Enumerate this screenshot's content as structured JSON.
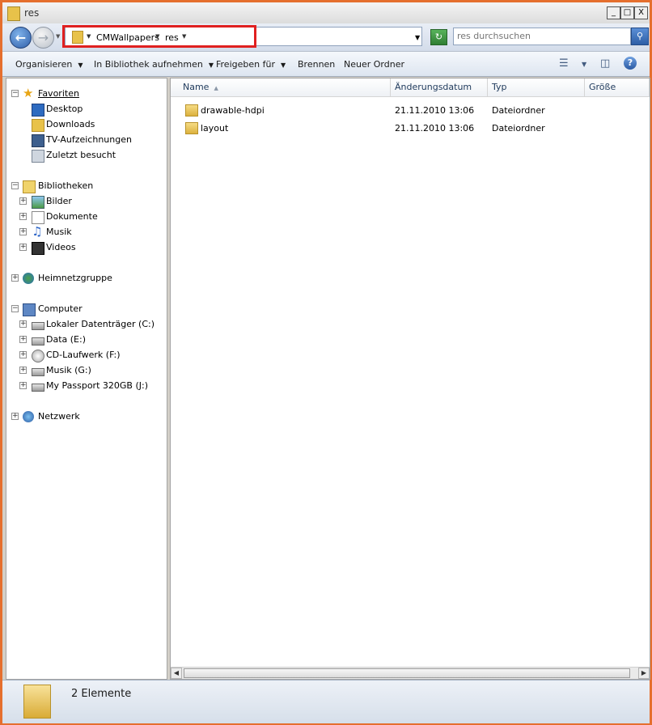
{
  "window": {
    "title": "res"
  },
  "titlebar_buttons": {
    "minimize": "_",
    "maximize": "□",
    "close": "X"
  },
  "address": {
    "crumbs": [
      "CMWallpapers",
      "res"
    ],
    "search_placeholder": "res durchsuchen",
    "search_value": ""
  },
  "toolbar": {
    "organize": "Organisieren",
    "include_library": "In Bibliothek aufnehmen",
    "share_with": "Freigeben für",
    "burn": "Brennen",
    "new_folder": "Neuer Ordner",
    "help": "?"
  },
  "nav": {
    "favorites": {
      "label": "Favoriten",
      "items": [
        "Desktop",
        "Downloads",
        "TV-Aufzeichnungen",
        "Zuletzt besucht"
      ]
    },
    "libraries": {
      "label": "Bibliotheken",
      "items": [
        "Bilder",
        "Dokumente",
        "Musik",
        "Videos"
      ]
    },
    "homegroup": "Heimnetzgruppe",
    "computer": {
      "label": "Computer",
      "items": [
        "Lokaler Datenträger (C:)",
        "Data (E:)",
        "CD-Laufwerk (F:)",
        "Musik (G:)",
        "My Passport 320GB (J:)"
      ]
    },
    "network": "Netzwerk"
  },
  "columns": {
    "name": "Name",
    "date": "Änderungsdatum",
    "type": "Typ",
    "size": "Größe"
  },
  "files": [
    {
      "name": "drawable-hdpi",
      "date": "21.11.2010 13:06",
      "type": "Dateiordner",
      "size": ""
    },
    {
      "name": "layout",
      "date": "21.11.2010 13:06",
      "type": "Dateiordner",
      "size": ""
    }
  ],
  "status": {
    "text": "2 Elemente"
  },
  "colors": {
    "window_border": "#e56f2e",
    "highlight_box": "#e02020",
    "folder": "#e8c24a"
  }
}
